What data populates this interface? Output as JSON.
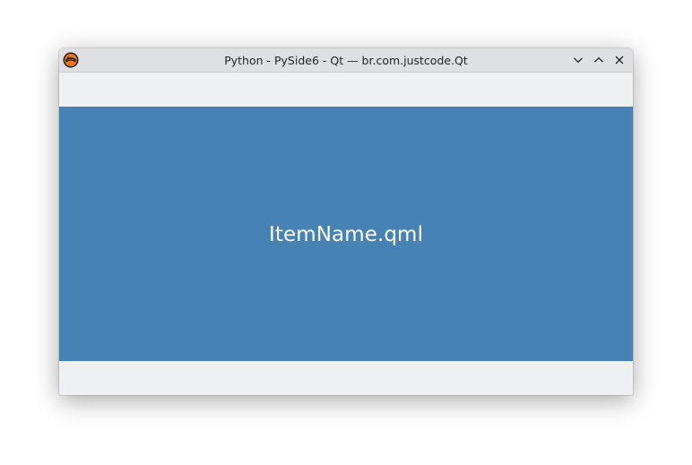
{
  "window": {
    "title": "Python - PySide6 - Qt — br.com.justcode.Qt",
    "app_icon": "python-app-icon",
    "controls": {
      "minimize_icon": "chevron-down-icon",
      "maximize_icon": "chevron-up-icon",
      "close_icon": "close-icon"
    }
  },
  "content": {
    "label": "ItemName.qml",
    "background_color": "#4682b4",
    "text_color": "#ffffff"
  }
}
